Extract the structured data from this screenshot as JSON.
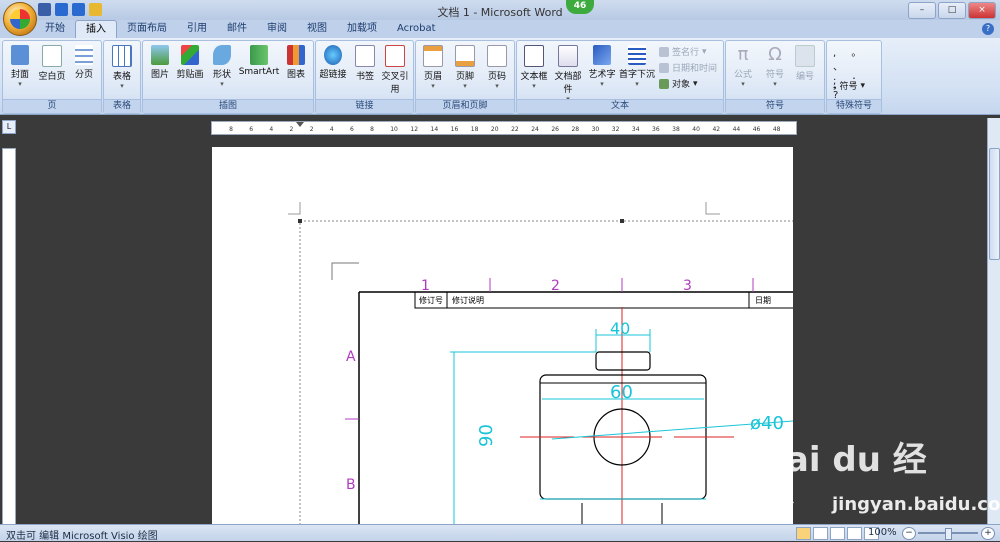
{
  "window": {
    "title": "文档 1 - Microsoft Word",
    "badge": "46"
  },
  "tabs": [
    "开始",
    "插入",
    "页面布局",
    "引用",
    "邮件",
    "审阅",
    "视图",
    "加载项",
    "Acrobat"
  ],
  "active_tab": "插入",
  "ribbon": {
    "groups": [
      {
        "label": "页",
        "buttons": [
          "封面",
          "空白页",
          "分页"
        ]
      },
      {
        "label": "表格",
        "buttons": [
          "表格"
        ]
      },
      {
        "label": "插图",
        "buttons": [
          "图片",
          "剪贴画",
          "形状",
          "SmartArt",
          "图表"
        ]
      },
      {
        "label": "链接",
        "buttons": [
          "超链接",
          "书签",
          "交叉引用"
        ]
      },
      {
        "label": "页眉和页脚",
        "buttons": [
          "页眉",
          "页脚",
          "页码"
        ]
      },
      {
        "label": "文本",
        "buttons": [
          "文本框",
          "文档部件",
          "艺术字",
          "首字下沉"
        ],
        "small": [
          "签名行",
          "日期和时间",
          "对象"
        ]
      },
      {
        "label": "符号",
        "buttons": [
          "公式",
          "符号",
          "编号"
        ]
      },
      {
        "label": "特殊符号",
        "buttons": [
          "符号"
        ]
      }
    ]
  },
  "ruler_numbers": [
    "8",
    "6",
    "4",
    "2",
    "2",
    "4",
    "6",
    "8",
    "10",
    "12",
    "14",
    "16",
    "18",
    "20",
    "22",
    "24",
    "26",
    "28",
    "30",
    "32",
    "34",
    "36",
    "38",
    "40",
    "42",
    "44",
    "46",
    "48"
  ],
  "drawing": {
    "columns": [
      "1",
      "2",
      "3"
    ],
    "rows": [
      "A",
      "B"
    ],
    "table_headers": [
      "修订号",
      "修订说明",
      "日期"
    ],
    "dimensions": [
      "40",
      "60",
      "90",
      "ø40"
    ]
  },
  "status": {
    "text": "双击可 编辑 Microsoft Visio 绘图",
    "zoom": "100%"
  },
  "watermark": {
    "text": "Bai du 经验",
    "url": "jingyan.baidu.com"
  },
  "colors": {
    "accent": "#c4d6ee",
    "cad_cyan": "#19c4d8",
    "cad_magenta": "#b03cc0",
    "cad_red": "#d22"
  }
}
